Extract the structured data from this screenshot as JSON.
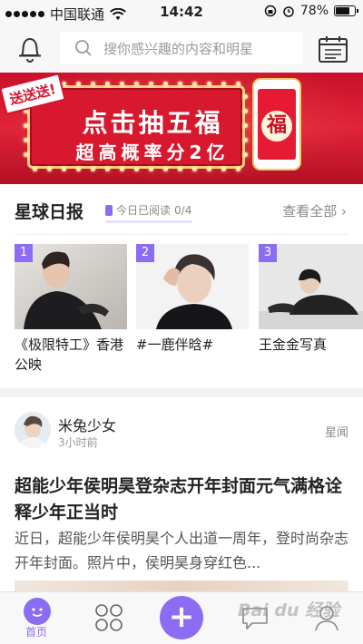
{
  "status_bar": {
    "carrier": "中国联通",
    "time": "14:42",
    "battery": "78%",
    "battery_level": 0.78
  },
  "header": {
    "search_placeholder": "搜你感兴趣的内容和明星"
  },
  "banner": {
    "tag": "送送送!",
    "title": "点击抽五福",
    "subtitle": "超高概率分2亿",
    "phone_char": "福"
  },
  "daily": {
    "title": "星球日报",
    "read_label": "今日已阅读",
    "read_count": "0/4",
    "see_all": "查看全部 ›"
  },
  "cards": [
    {
      "num": "1",
      "caption": "《极限特工》香港公映"
    },
    {
      "num": "2",
      "caption": "#一鹿伴晗#"
    },
    {
      "num": "3",
      "caption": "王金金写真"
    }
  ],
  "article": {
    "author": "米兔少女",
    "time_ago": "3小时前",
    "channel": "星闻",
    "title": "超能少年侯明昊登杂志开年封面元气满格诠释少年正当时",
    "summary": "近日，超能少年侯明昊个人出道一周年，登时尚杂志开年封面。照片中，侯明昊身穿红色..."
  },
  "tabbar": {
    "home": "首页"
  },
  "watermark": "Bai du 经验",
  "colors": {
    "accent": "#8c6cf2",
    "banner_red": "#d8182f"
  }
}
